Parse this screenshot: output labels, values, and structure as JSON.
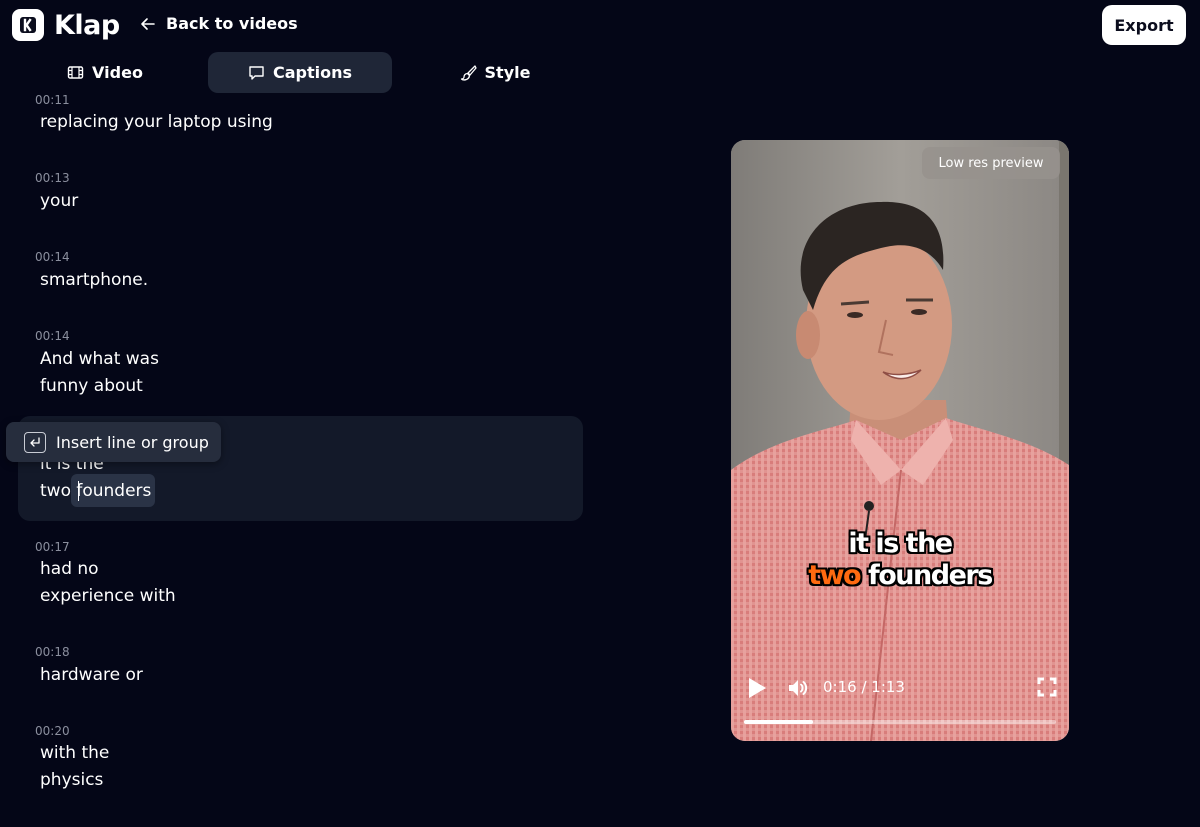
{
  "header": {
    "logo_text": "Klap",
    "back_label": "Back to videos",
    "export_label": "Export"
  },
  "tabs": [
    {
      "label": "Video",
      "icon": "film-icon",
      "active": false
    },
    {
      "label": "Captions",
      "icon": "speech-bubble-icon",
      "active": true
    },
    {
      "label": "Style",
      "icon": "brush-icon",
      "active": false
    }
  ],
  "captions": [
    {
      "time": "00:11",
      "text": "replacing your laptop using"
    },
    {
      "time": "00:13",
      "text": "your"
    },
    {
      "time": "00:14",
      "text": "smartphone."
    },
    {
      "time": "00:14",
      "text": "And what was\nfunny about"
    },
    {
      "time": "",
      "text": "it is the\ntwo founders"
    },
    {
      "time": "00:17",
      "text": "had no\nexperience with"
    },
    {
      "time": "00:18",
      "text": "hardware or"
    },
    {
      "time": "00:20",
      "text": "with the\nphysics"
    }
  ],
  "tooltip": {
    "label": "Insert line or group",
    "icon": "enter-key-icon"
  },
  "preview": {
    "badge": "Low res preview",
    "subtitle_line1": "it is the",
    "subtitle_line2_accent": "two",
    "subtitle_line2_rest": " founders",
    "time_display": "0:16 / 1:13",
    "progress": 0.22,
    "accent_color": "#ff6a10"
  }
}
